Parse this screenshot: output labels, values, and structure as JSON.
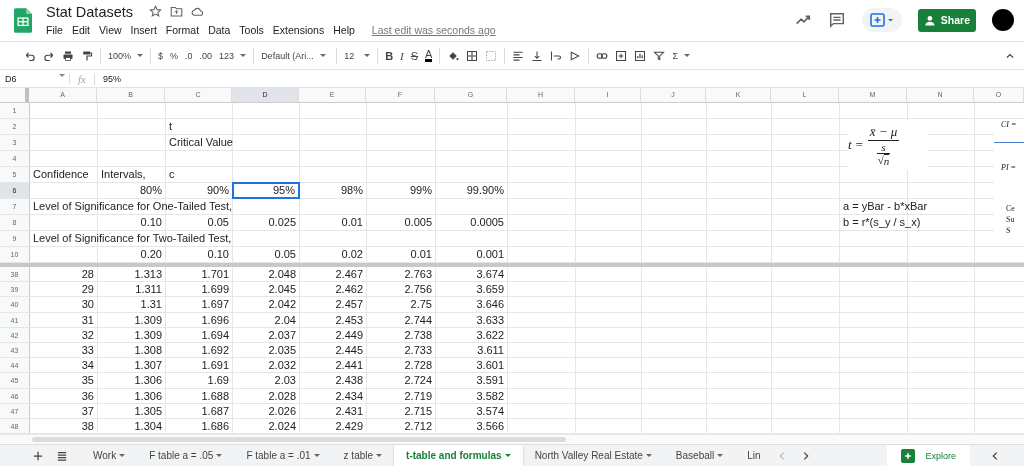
{
  "document": {
    "title": "Stat Datasets",
    "last_edit": "Last edit was seconds ago"
  },
  "menu": [
    "File",
    "Edit",
    "View",
    "Insert",
    "Format",
    "Data",
    "Tools",
    "Extensions",
    "Help"
  ],
  "share_button": "Share",
  "toolbar": {
    "zoom": "100%",
    "currency": "$",
    "percent": "%",
    "decrease_decimals": ".0",
    "increase_decimals": ".00",
    "number_format": "123",
    "font": "Default (Ari...",
    "font_size": "12",
    "bold": "B",
    "italic": "I",
    "strikethrough": "S",
    "text_color": "A",
    "functions": "Σ"
  },
  "formula_bar": {
    "cell": "D6",
    "fx": "fx",
    "value": "95%"
  },
  "columns": [
    "A",
    "B",
    "C",
    "D",
    "E",
    "F",
    "G",
    "H",
    "I",
    "J",
    "K",
    "L",
    "M",
    "N",
    "O"
  ],
  "frozen_rows": [
    {
      "number": "1",
      "cells": {}
    },
    {
      "number": "2",
      "cells": {
        "C": {
          "text": "t",
          "kind": "text",
          "selected": false
        }
      }
    },
    {
      "number": "3",
      "cells": {
        "C": {
          "text": "Critical Value",
          "kind": "text",
          "selected": false
        }
      }
    },
    {
      "number": "4",
      "cells": {}
    },
    {
      "number": "5",
      "cells": {
        "A": {
          "text": "Confidence",
          "kind": "text",
          "selected": false
        },
        "B": {
          "text": "Intervals,",
          "kind": "text",
          "selected": false
        },
        "C": {
          "text": "c",
          "kind": "text",
          "selected": false
        }
      }
    },
    {
      "number": "6",
      "cells": {
        "B": {
          "text": "80%",
          "kind": "num",
          "selected": false
        },
        "C": {
          "text": "90%",
          "kind": "num",
          "selected": false
        },
        "D": {
          "text": "95%",
          "kind": "num",
          "selected": true
        },
        "E": {
          "text": "98%",
          "kind": "num",
          "selected": false
        },
        "F": {
          "text": "99%",
          "kind": "num",
          "selected": false
        },
        "G": {
          "text": "99.90%",
          "kind": "num",
          "selected": false
        }
      }
    },
    {
      "number": "7",
      "cells": {
        "A": {
          "text": "Level of Significance for One-Tailed Test,",
          "kind": "text",
          "selected": false
        },
        "M": {
          "text": "a = yBar - b*xBar",
          "kind": "text",
          "selected": false
        }
      }
    },
    {
      "number": "8",
      "cells": {
        "B": {
          "text": "0.10",
          "kind": "num",
          "selected": false
        },
        "C": {
          "text": "0.05",
          "kind": "num",
          "selected": false
        },
        "D": {
          "text": "0.025",
          "kind": "num",
          "selected": false
        },
        "E": {
          "text": "0.01",
          "kind": "num",
          "selected": false
        },
        "F": {
          "text": "0.005",
          "kind": "num",
          "selected": false
        },
        "G": {
          "text": "0.0005",
          "kind": "num",
          "selected": false
        },
        "M": {
          "text": "b = r*(s_y / s_x)",
          "kind": "text",
          "selected": false
        }
      }
    },
    {
      "number": "9",
      "cells": {
        "A": {
          "text": "Level of Significance for Two-Tailed Test,",
          "kind": "text",
          "selected": false
        }
      }
    },
    {
      "number": "10",
      "cells": {
        "B": {
          "text": "0.20",
          "kind": "num",
          "selected": false
        },
        "C": {
          "text": "0.10",
          "kind": "num",
          "selected": false
        },
        "D": {
          "text": "0.05",
          "kind": "num",
          "selected": false
        },
        "E": {
          "text": "0.02",
          "kind": "num",
          "selected": false
        },
        "F": {
          "text": "0.01",
          "kind": "num",
          "selected": false
        },
        "G": {
          "text": "0.001",
          "kind": "num",
          "selected": false
        }
      }
    }
  ],
  "rows": [
    {
      "number": "38",
      "values": [
        "28",
        "1.313",
        "1.701",
        "2.048",
        "2.467",
        "2.763",
        "3.674"
      ]
    },
    {
      "number": "39",
      "values": [
        "29",
        "1.311",
        "1.699",
        "2.045",
        "2.462",
        "2.756",
        "3.659"
      ]
    },
    {
      "number": "40",
      "values": [
        "30",
        "1.31",
        "1.697",
        "2.042",
        "2.457",
        "2.75",
        "3.646"
      ]
    },
    {
      "number": "41",
      "values": [
        "31",
        "1.309",
        "1.696",
        "2.04",
        "2.453",
        "2.744",
        "3.633"
      ]
    },
    {
      "number": "42",
      "values": [
        "32",
        "1.309",
        "1.694",
        "2.037",
        "2.449",
        "2.738",
        "3.622"
      ]
    },
    {
      "number": "43",
      "values": [
        "33",
        "1.308",
        "1.692",
        "2.035",
        "2.445",
        "2.733",
        "3.611"
      ]
    },
    {
      "number": "44",
      "values": [
        "34",
        "1.307",
        "1.691",
        "2.032",
        "2.441",
        "2.728",
        "3.601"
      ]
    },
    {
      "number": "45",
      "values": [
        "35",
        "1.306",
        "1.69",
        "2.03",
        "2.438",
        "2.724",
        "3.591"
      ]
    },
    {
      "number": "46",
      "values": [
        "36",
        "1.306",
        "1.688",
        "2.028",
        "2.434",
        "2.719",
        "3.582"
      ]
    },
    {
      "number": "47",
      "values": [
        "37",
        "1.305",
        "1.687",
        "2.026",
        "2.431",
        "2.715",
        "3.574"
      ]
    },
    {
      "number": "48",
      "values": [
        "38",
        "1.304",
        "1.686",
        "2.024",
        "2.429",
        "2.712",
        "3.566"
      ]
    }
  ],
  "formula_image": {
    "lhs": "t =",
    "numerator": "x̄ − μ",
    "denominator_top": "s",
    "root_sign": "√",
    "denominator_root": "n"
  },
  "side_image": {
    "lines": [
      "CI =",
      "PI =",
      "Ce",
      "Su",
      "S"
    ]
  },
  "sheet_tabs": [
    {
      "label": "Work",
      "selected": false
    },
    {
      "label": "F table a = .05",
      "selected": false
    },
    {
      "label": "F table a = .01",
      "selected": false
    },
    {
      "label": "z table",
      "selected": false
    },
    {
      "label": "t-table and formulas",
      "selected": true
    },
    {
      "label": "North Valley Real Estate",
      "selected": false
    },
    {
      "label": "Baseball",
      "selected": false
    },
    {
      "label": "Lin",
      "selected": false
    }
  ],
  "explore_button": "Explore"
}
